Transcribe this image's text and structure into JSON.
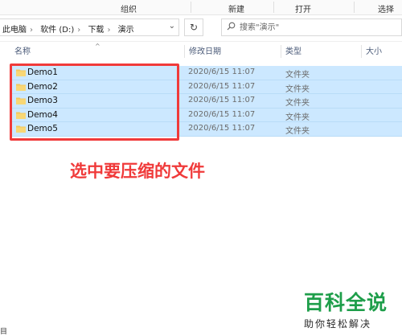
{
  "ribbon": {
    "groups": [
      "组织",
      "新建",
      "打开",
      "选择"
    ]
  },
  "address": {
    "crumbs": [
      "此电脑",
      "软件 (D:)",
      "下载",
      "演示"
    ],
    "dropdown_icon": "chevron-down-icon",
    "refresh_icon": "refresh-icon"
  },
  "search": {
    "placeholder": "搜索\"演示\""
  },
  "columns": {
    "name": "名称",
    "modified": "修改日期",
    "type": "类型",
    "size": "大小"
  },
  "files": [
    {
      "name": "Demo1",
      "date": "2020/6/15 11:07",
      "type": "文件夹"
    },
    {
      "name": "Demo2",
      "date": "2020/6/15 11:07",
      "type": "文件夹"
    },
    {
      "name": "Demo3",
      "date": "2020/6/15 11:07",
      "type": "文件夹"
    },
    {
      "name": "Demo4",
      "date": "2020/6/15 11:07",
      "type": "文件夹"
    },
    {
      "name": "Demo5",
      "date": "2020/6/15 11:07",
      "type": "文件夹"
    }
  ],
  "annotation": "选中要压缩的文件",
  "watermark": {
    "main": "百科全说",
    "sub": "助你轻松解决"
  },
  "status": {
    "count_glyph": "目"
  },
  "colors": {
    "selection": "#cce8ff",
    "highlight": "#f03a3a",
    "watermark_green": "#1e9e4a",
    "folder": "#f3c75a"
  }
}
